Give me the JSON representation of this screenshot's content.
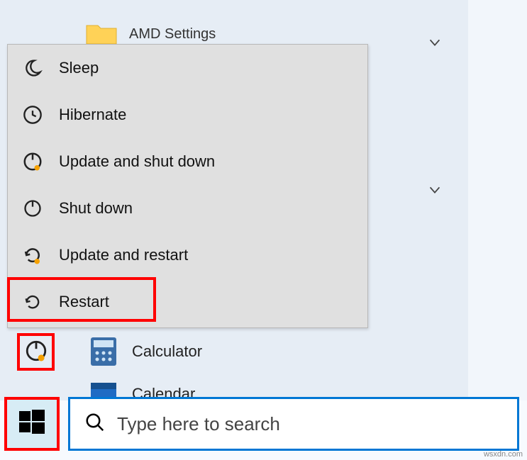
{
  "folder": {
    "label": "AMD Settings"
  },
  "power_menu": {
    "items": [
      {
        "id": "sleep",
        "label": "Sleep"
      },
      {
        "id": "hibernate",
        "label": "Hibernate"
      },
      {
        "id": "update-shutdown",
        "label": "Update and shut down"
      },
      {
        "id": "shutdown",
        "label": "Shut down"
      },
      {
        "id": "update-restart",
        "label": "Update and restart"
      },
      {
        "id": "restart",
        "label": "Restart"
      }
    ]
  },
  "apps": {
    "calculator": "Calculator",
    "calendar": "Calendar"
  },
  "search": {
    "placeholder": "Type here to search"
  },
  "watermark": "wsxdn.com",
  "colors": {
    "highlight": "#ff0000",
    "accent": "#0077d4"
  }
}
